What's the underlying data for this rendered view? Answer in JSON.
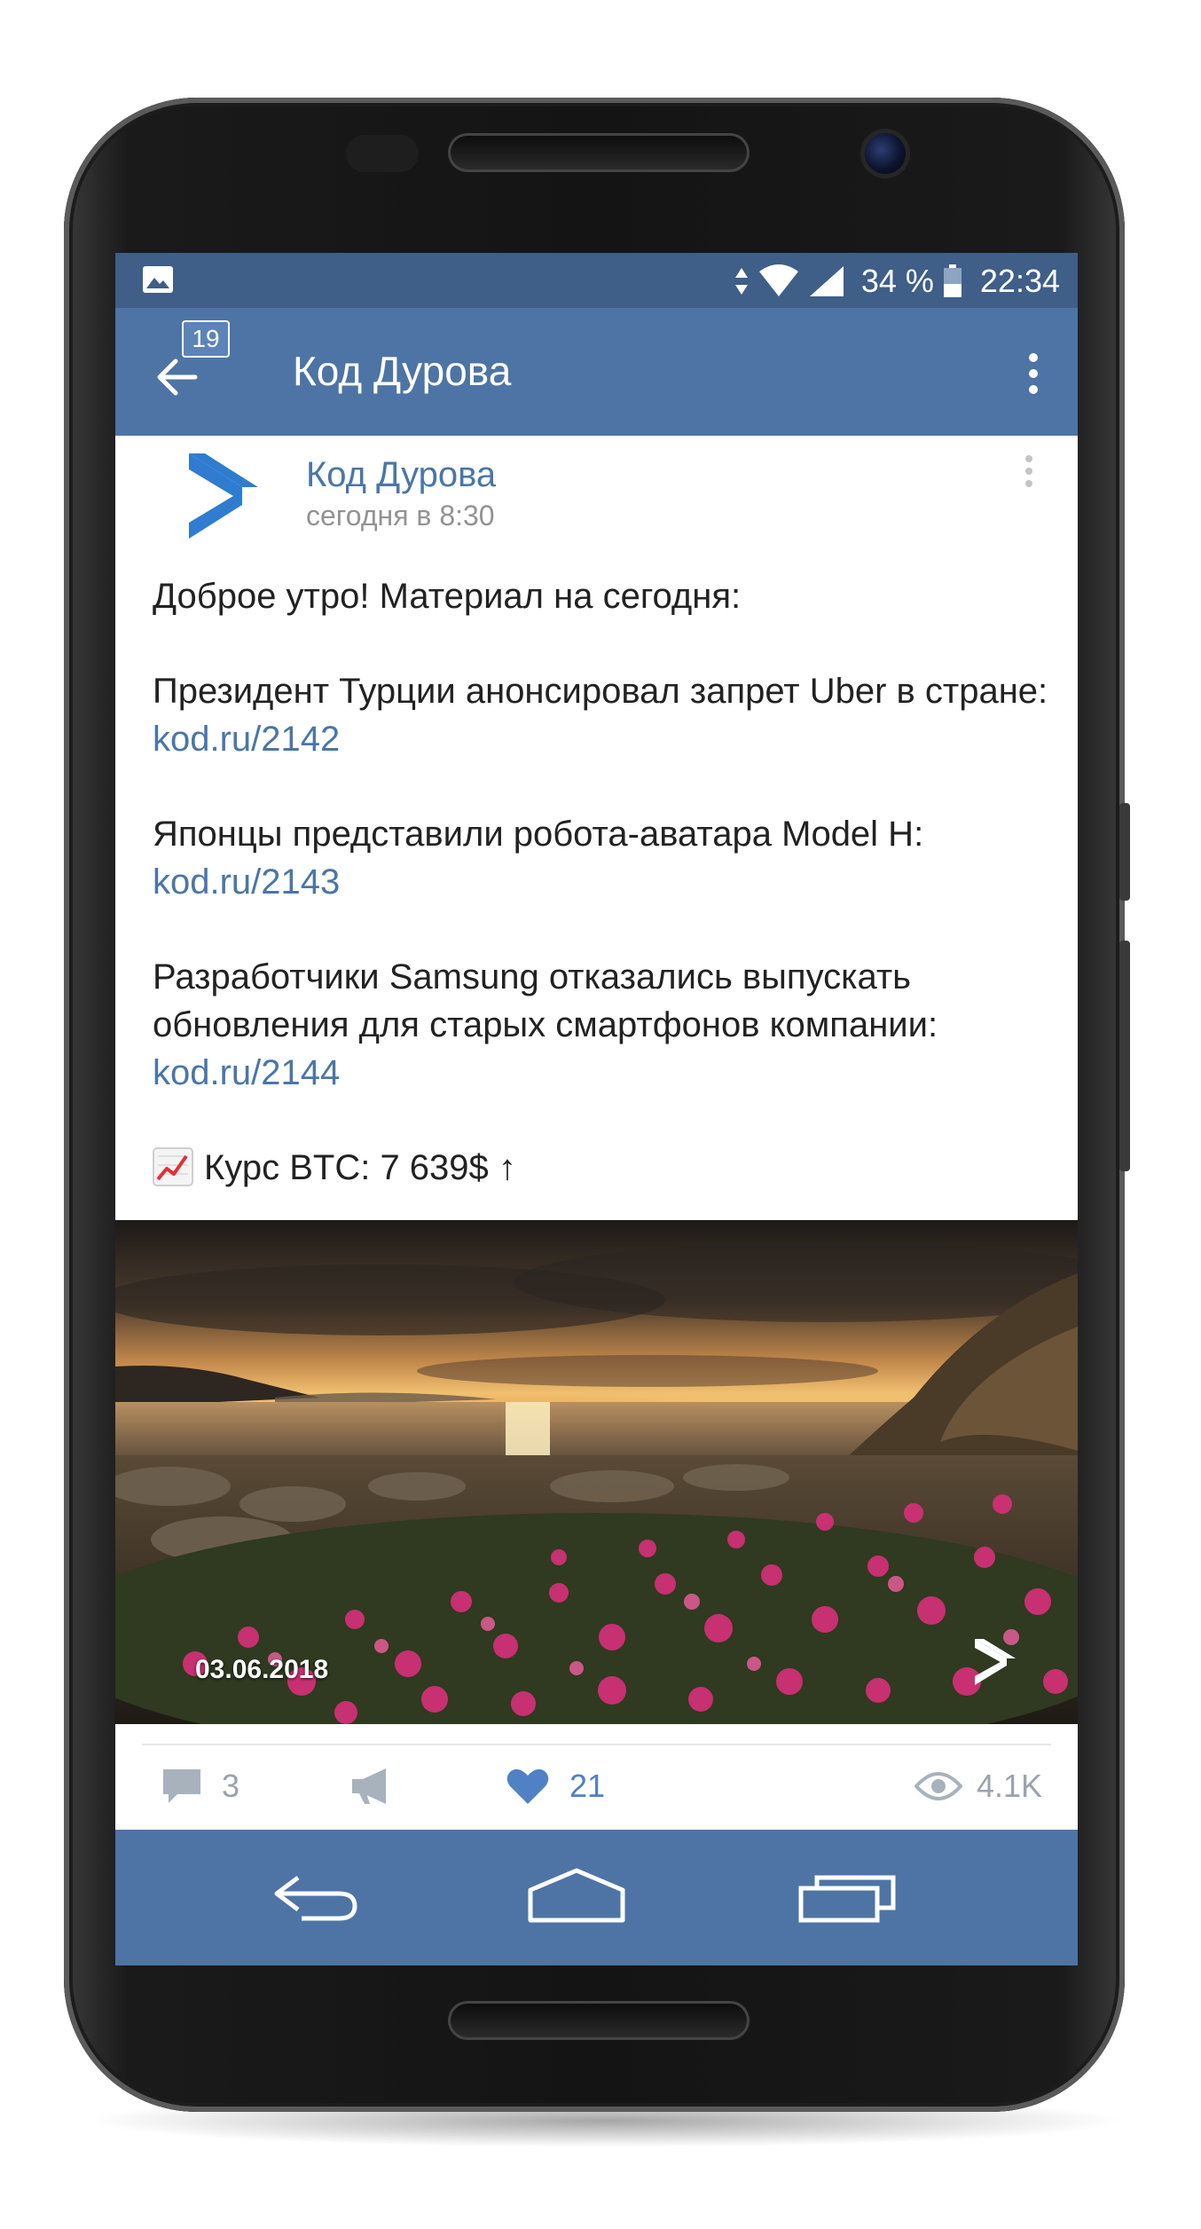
{
  "status_bar": {
    "battery": "34 %",
    "time": "22:34",
    "icons": [
      "gallery-icon",
      "data-arrows-icon",
      "wifi-icon",
      "signal-icon",
      "battery-icon"
    ]
  },
  "app_bar": {
    "title": "Код Дурова",
    "badge_count": "19",
    "icons": [
      "back-arrow-icon",
      "more-vertical-icon"
    ]
  },
  "post": {
    "author": "Код Дурова",
    "time": "сегодня в 8:30",
    "intro": "Доброе утро! Материал на сегодня:",
    "items": [
      {
        "text": "Президент Турции анонсировал запрет Uber в стране: ",
        "link": "kod.ru/2142"
      },
      {
        "text": "Японцы представили робота-аватара Model H: ",
        "link": "kod.ru/2143"
      },
      {
        "text": "Разработчики Samsung отказались выпускать обновления для старых смартфонов компании: ",
        "link": "kod.ru/2144"
      }
    ],
    "btc": "Курс BTC: 7 639$ ↑",
    "photo_date": "03.06.2018"
  },
  "actions": {
    "comments": "3",
    "likes": "21",
    "views": "4.1K"
  },
  "colors": {
    "status_bar": "#3f5e88",
    "app_bar": "#4d74a5",
    "link": "#4a76a8",
    "like": "#5081c4"
  }
}
